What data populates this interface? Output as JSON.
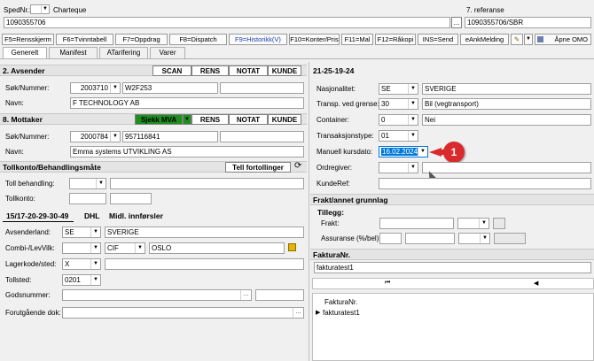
{
  "top": {
    "spednr_label": "SpedNr.:",
    "charteque_label": "Charteque",
    "ref_label": "7. referanse",
    "spednr_value": "1090355706",
    "ref_value": "1090355706/SBR",
    "ellipsis": "..."
  },
  "toolbar": [
    "F5=Rensskjerm",
    "F6=Tvinntabell",
    "F7=Oppdrag",
    "F8=Dispatch",
    "F9=Historikk(V)",
    "F10=Konter/Pris",
    "F11=Mal",
    "F12=Råkopi",
    "INS=Send",
    "eAnkMelding",
    "Åpne OMO"
  ],
  "tabs": [
    "Generelt",
    "Manifest",
    "ATarifering",
    "Varer"
  ],
  "avsender": {
    "title": "2. Avsender",
    "scan": "SCAN",
    "rens": "RENS",
    "notat": "NOTAT",
    "kunde": "KUNDE",
    "sok_label": "Søk/Nummer:",
    "sok_value": "2003710",
    "code": "W2F253",
    "navn_label": "Navn:",
    "navn_value": "F TECHNOLOGY AB"
  },
  "mottaker": {
    "title": "8. Mottaker",
    "sjekk": "Sjekk MVA",
    "rens": "RENS",
    "notat": "NOTAT",
    "kunde": "KUNDE",
    "sok_label": "Søk/Nummer:",
    "sok_value": "2000784",
    "code": "957116841",
    "navn_label": "Navn:",
    "navn_value": "Emma systems UTVIKLING AS"
  },
  "toll": {
    "title": "Tollkonto/Behandlingsmåte",
    "fortollinger": "Tell fortollinger",
    "behandling_label": "Toll behandling:",
    "tollkonto_label": "Tollkonto:"
  },
  "subtabs": [
    "15/17-20-29-30-49",
    "DHL",
    "Midl. innførsler"
  ],
  "details": {
    "avsenderland_label": "Avsenderland:",
    "avsenderland_code": "SE",
    "avsenderland_name": "SVERIGE",
    "combi_label": "Combi-/LevVilk:",
    "combi_term": "CIF",
    "combi_place": "OSLO",
    "lager_label": "Lagerkode/sted:",
    "lager_code": "X",
    "tollsted_label": "Tollsted:",
    "tollsted_value": "0201",
    "gods_label": "Godsnummer:",
    "forut_label": "Forutgående dok:"
  },
  "right": {
    "title": "21-25-19-24",
    "nasjonalitet_label": "Nasjonalitet:",
    "nasjonalitet_code": "SE",
    "nasjonalitet_name": "SVERIGE",
    "transp_label": "Transp. ved grense:",
    "transp_code": "30",
    "transp_name": "Bil (vegtransport)",
    "container_label": "Container:",
    "container_code": "0",
    "container_name": "Nei",
    "transtype_label": "Transaksjonstype:",
    "transtype_code": "01",
    "kurs_label": "Manuell kursdato:",
    "kurs_value": "16.02.2024",
    "ordregiver_label": "Ordregiver:",
    "kunderef_label": "KundeRef:",
    "callout": "1"
  },
  "frakt": {
    "title": "Frakt/annet grunnlag",
    "tillegg": "Tillegg:",
    "frakt_label": "Frakt:",
    "assuranse_label": "Assuranse (%/bel)"
  },
  "faktura": {
    "title": "FakturaNr.",
    "input_value": "fakturatest1",
    "nav_first": "⏮",
    "nav_prev": "◀",
    "col_header": "FakturaNr.",
    "row1": "fakturatest1",
    "row_marker": "▶"
  },
  "colors": {
    "accent_green": "#1d8f1d",
    "select_blue": "#0078d7",
    "callout_red": "#d92b2b"
  }
}
